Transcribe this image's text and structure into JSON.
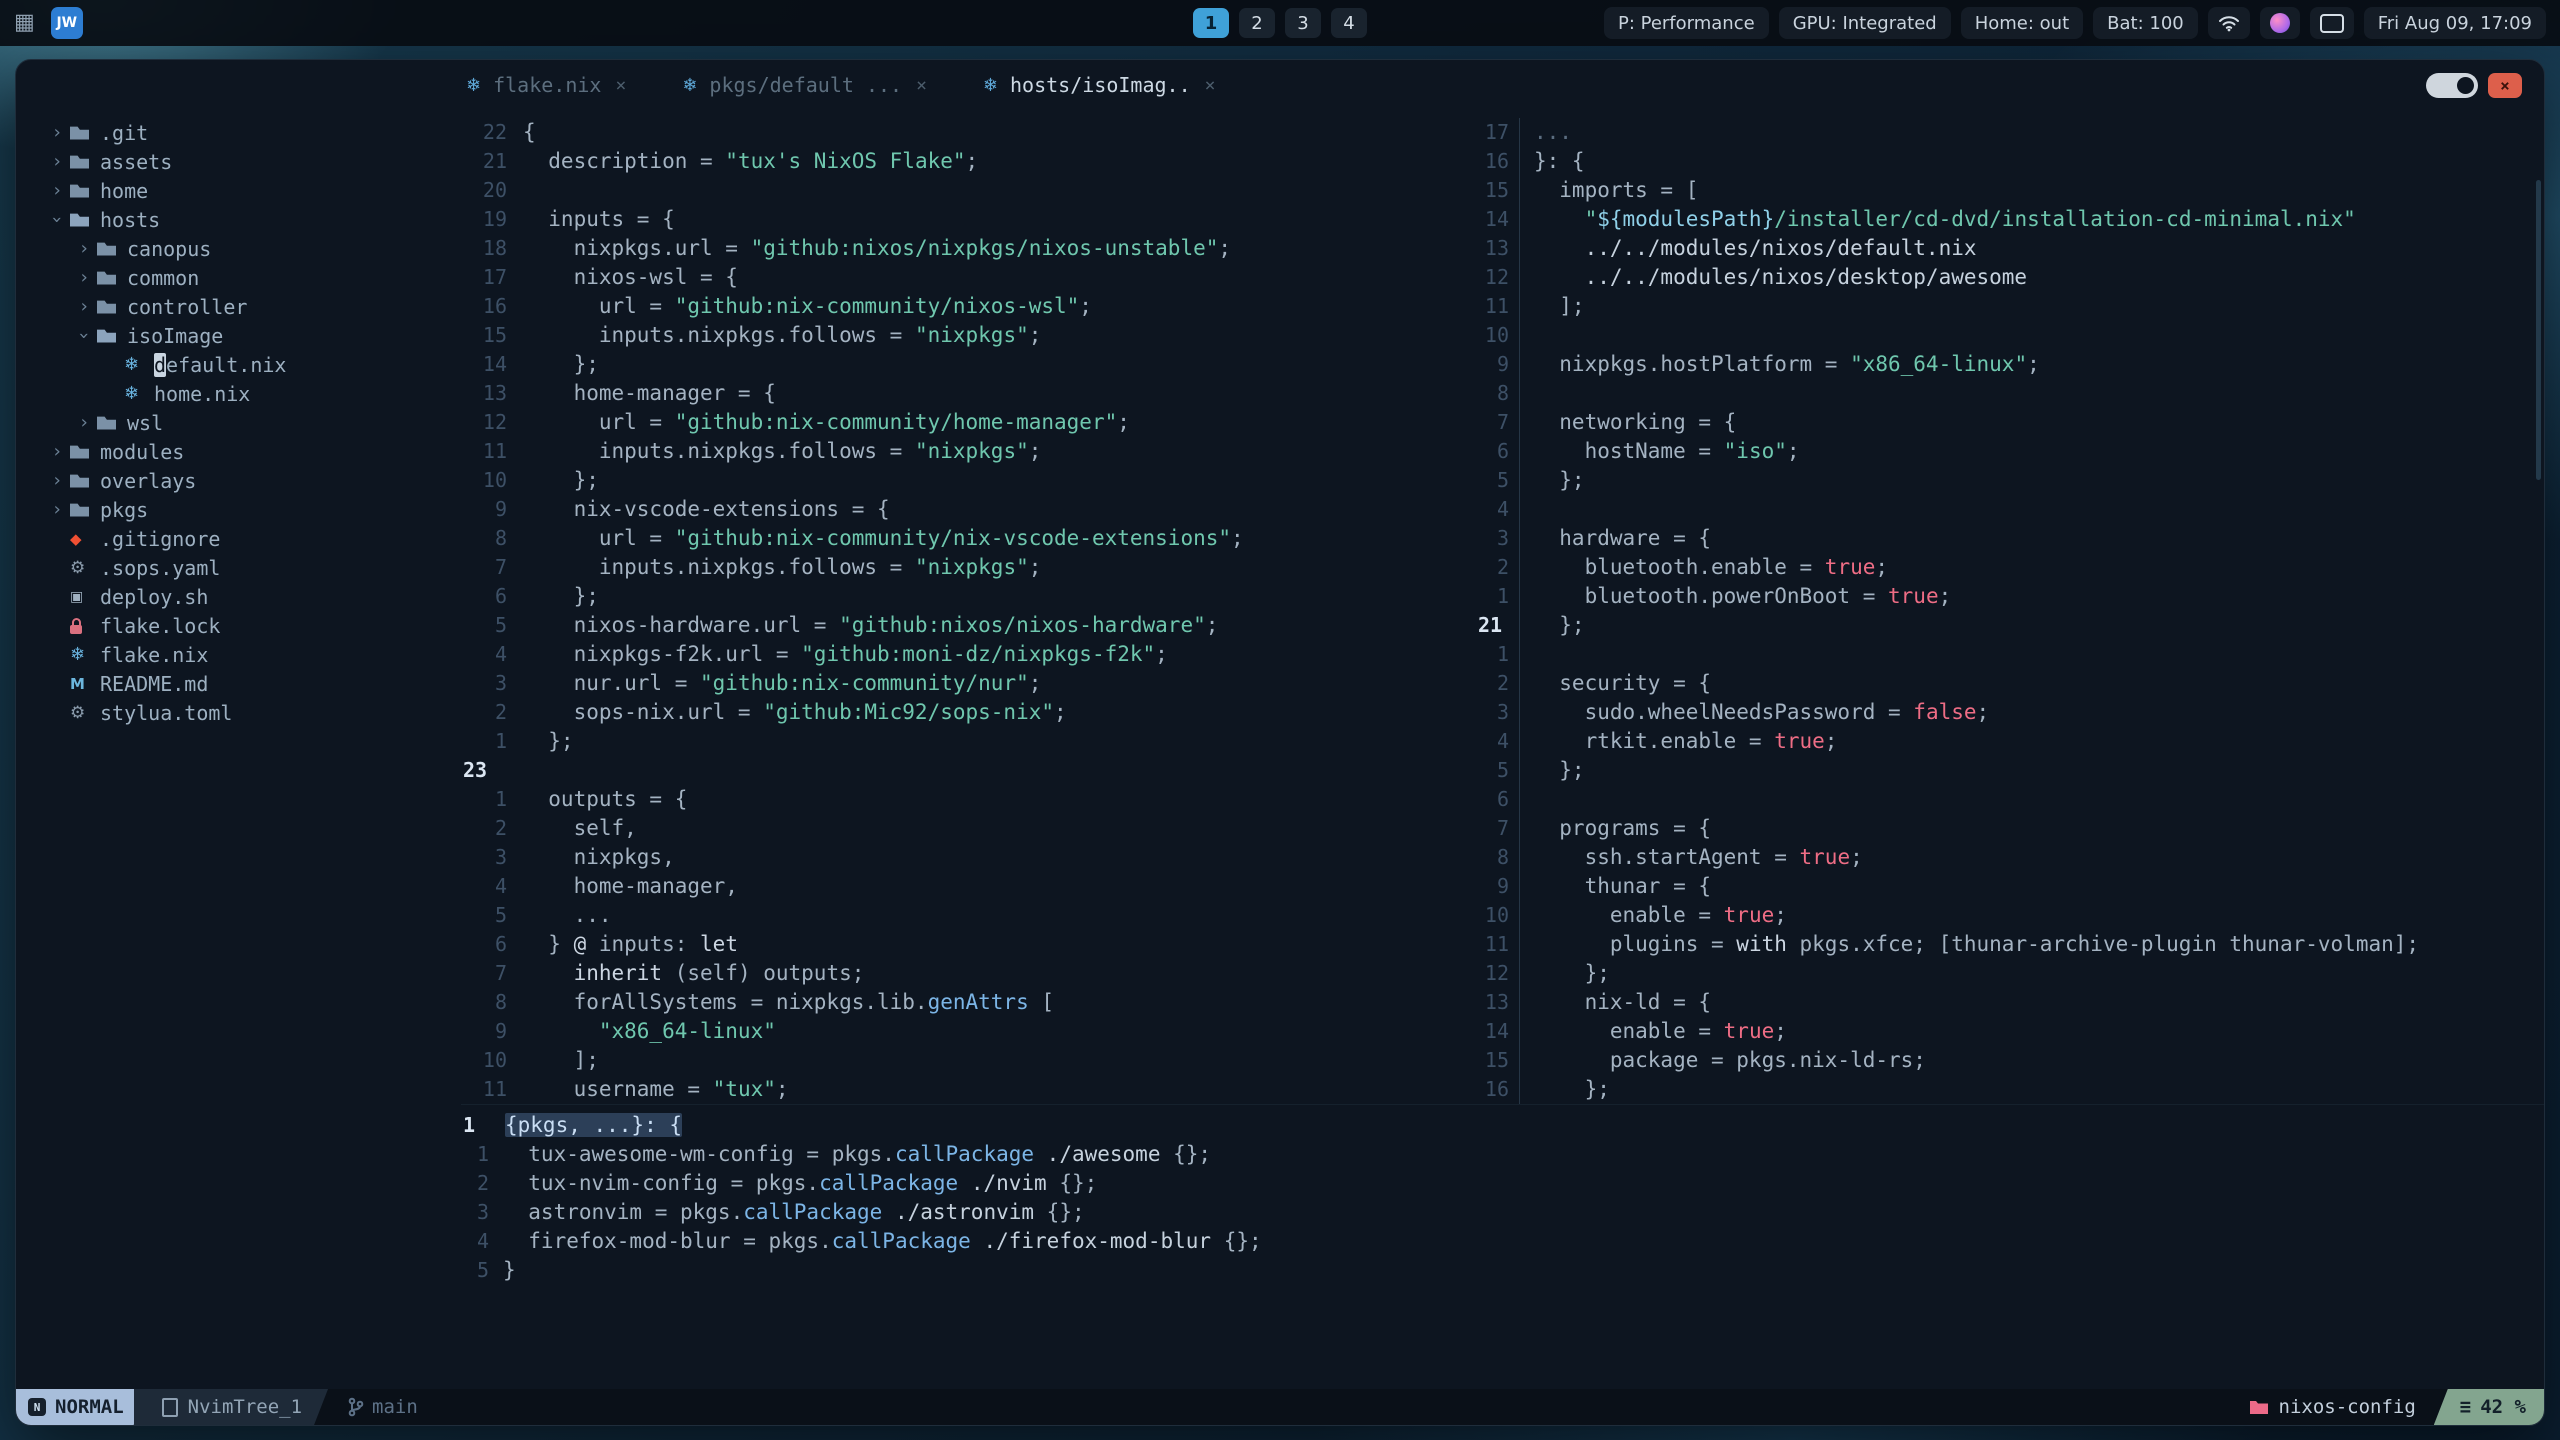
{
  "topbar": {
    "logo": "JW",
    "workspaces": {
      "items": [
        "1",
        "2",
        "3",
        "4"
      ],
      "active": "1"
    },
    "status_items": [
      "P: Performance",
      "GPU: Integrated",
      "Home: out",
      "Bat: 100"
    ],
    "clock": "Fri Aug 09, 17:09"
  },
  "window": {
    "tabs": [
      {
        "label": "flake.nix",
        "icon": "nix",
        "active": false
      },
      {
        "label": "pkgs/default ...",
        "icon": "nix",
        "active": false
      },
      {
        "label": "hosts/isoImag..",
        "icon": "nix",
        "active": true
      }
    ]
  },
  "tree": {
    "items": [
      {
        "indent": 0,
        "arrow": "closed",
        "icon": "folder",
        "label": ".git"
      },
      {
        "indent": 0,
        "arrow": "closed",
        "icon": "folder",
        "label": "assets"
      },
      {
        "indent": 0,
        "arrow": "closed",
        "icon": "folder",
        "label": "home"
      },
      {
        "indent": 0,
        "arrow": "open",
        "icon": "folder-open",
        "label": "hosts"
      },
      {
        "indent": 1,
        "arrow": "closed",
        "icon": "folder",
        "label": "canopus"
      },
      {
        "indent": 1,
        "arrow": "closed",
        "icon": "folder",
        "label": "common"
      },
      {
        "indent": 1,
        "arrow": "closed",
        "icon": "folder",
        "label": "controller"
      },
      {
        "indent": 1,
        "arrow": "open",
        "icon": "folder-open",
        "label": "isoImage"
      },
      {
        "indent": 2,
        "arrow": "none",
        "icon": "nix",
        "label": "default.nix",
        "cursor": true
      },
      {
        "indent": 2,
        "arrow": "none",
        "icon": "nix",
        "label": "home.nix"
      },
      {
        "indent": 1,
        "arrow": "closed",
        "icon": "folder",
        "label": "wsl"
      },
      {
        "indent": 0,
        "arrow": "closed",
        "icon": "folder",
        "label": "modules"
      },
      {
        "indent": 0,
        "arrow": "closed",
        "icon": "folder",
        "label": "overlays"
      },
      {
        "indent": 0,
        "arrow": "closed",
        "icon": "folder",
        "label": "pkgs"
      },
      {
        "indent": 0,
        "arrow": "none",
        "icon": "git",
        "label": ".gitignore"
      },
      {
        "indent": 0,
        "arrow": "none",
        "icon": "yaml",
        "label": ".sops.yaml"
      },
      {
        "indent": 0,
        "arrow": "none",
        "icon": "shell",
        "label": "deploy.sh"
      },
      {
        "indent": 0,
        "arrow": "none",
        "icon": "lock",
        "label": "flake.lock"
      },
      {
        "indent": 0,
        "arrow": "none",
        "icon": "nix",
        "label": "flake.nix"
      },
      {
        "indent": 0,
        "arrow": "none",
        "icon": "markdown",
        "label": "README.md"
      },
      {
        "indent": 0,
        "arrow": "none",
        "icon": "toml",
        "label": "stylua.toml"
      }
    ]
  },
  "panes": {
    "flake": {
      "lines": [
        [
          "22",
          0,
          [
            [
              "t",
              "{"
            ]
          ]
        ],
        [
          "21",
          0,
          [
            [
              "t",
              "  description = "
            ],
            [
              "s",
              "\"tux's NixOS Flake\""
            ],
            [
              "t",
              ";"
            ]
          ]
        ],
        [
          "20",
          0,
          []
        ],
        [
          "19",
          0,
          [
            [
              "t",
              "  inputs = {"
            ]
          ]
        ],
        [
          "18",
          0,
          [
            [
              "t",
              "    nixpkgs.url = "
            ],
            [
              "s",
              "\"github:nixos/nixpkgs/nixos-unstable\""
            ],
            [
              "t",
              ";"
            ]
          ]
        ],
        [
          "17",
          0,
          [
            [
              "t",
              "    nixos-wsl = {"
            ]
          ]
        ],
        [
          "16",
          0,
          [
            [
              "t",
              "      url = "
            ],
            [
              "s",
              "\"github:nix-community/nixos-wsl\""
            ],
            [
              "t",
              ";"
            ]
          ]
        ],
        [
          "15",
          0,
          [
            [
              "t",
              "      inputs.nixpkgs.follows = "
            ],
            [
              "s",
              "\"nixpkgs\""
            ],
            [
              "t",
              ";"
            ]
          ]
        ],
        [
          "14",
          0,
          [
            [
              "t",
              "    };"
            ]
          ]
        ],
        [
          "13",
          0,
          [
            [
              "t",
              "    home-manager = {"
            ]
          ]
        ],
        [
          "12",
          0,
          [
            [
              "t",
              "      url = "
            ],
            [
              "s",
              "\"github:nix-community/home-manager\""
            ],
            [
              "t",
              ";"
            ]
          ]
        ],
        [
          "11",
          0,
          [
            [
              "t",
              "      inputs.nixpkgs.follows = "
            ],
            [
              "s",
              "\"nixpkgs\""
            ],
            [
              "t",
              ";"
            ]
          ]
        ],
        [
          "10",
          0,
          [
            [
              "t",
              "    };"
            ]
          ]
        ],
        [
          "9",
          0,
          [
            [
              "t",
              "    nix-vscode-extensions = {"
            ]
          ]
        ],
        [
          "8",
          0,
          [
            [
              "t",
              "      url = "
            ],
            [
              "s",
              "\"github:nix-community/nix-vscode-extensions\""
            ],
            [
              "t",
              ";"
            ]
          ]
        ],
        [
          "7",
          0,
          [
            [
              "t",
              "      inputs.nixpkgs.follows = "
            ],
            [
              "s",
              "\"nixpkgs\""
            ],
            [
              "t",
              ";"
            ]
          ]
        ],
        [
          "6",
          0,
          [
            [
              "t",
              "    };"
            ]
          ]
        ],
        [
          "5",
          0,
          [
            [
              "t",
              "    nixos-hardware.url = "
            ],
            [
              "s",
              "\"github:nixos/nixos-hardware\""
            ],
            [
              "t",
              ";"
            ]
          ]
        ],
        [
          "4",
          0,
          [
            [
              "t",
              "    nixpkgs-f2k.url = "
            ],
            [
              "s",
              "\"github:moni-dz/nixpkgs-f2k\""
            ],
            [
              "t",
              ";"
            ]
          ]
        ],
        [
          "3",
          0,
          [
            [
              "t",
              "    nur.url = "
            ],
            [
              "s",
              "\"github:nix-community/nur\""
            ],
            [
              "t",
              ";"
            ]
          ]
        ],
        [
          "2",
          0,
          [
            [
              "t",
              "    sops-nix.url = "
            ],
            [
              "s",
              "\"github:Mic92/sops-nix\""
            ],
            [
              "t",
              ";"
            ]
          ]
        ],
        [
          "1",
          0,
          [
            [
              "t",
              "  };"
            ]
          ]
        ],
        [
          "23",
          1,
          []
        ],
        [
          "1",
          0,
          [
            [
              "t",
              "  outputs = {"
            ]
          ]
        ],
        [
          "2",
          0,
          [
            [
              "t",
              "    self,"
            ]
          ]
        ],
        [
          "3",
          0,
          [
            [
              "t",
              "    nixpkgs,"
            ]
          ]
        ],
        [
          "4",
          0,
          [
            [
              "t",
              "    home-manager,"
            ]
          ]
        ],
        [
          "5",
          0,
          [
            [
              "t",
              "    ..."
            ]
          ]
        ],
        [
          "6",
          0,
          [
            [
              "t",
              "  } "
            ],
            [
              "k",
              "@"
            ],
            [
              "t",
              " inputs: "
            ],
            [
              "k",
              "let"
            ]
          ]
        ],
        [
          "7",
          0,
          [
            [
              "t",
              "    "
            ],
            [
              "k",
              "inherit"
            ],
            [
              "t",
              " (self) outputs;"
            ]
          ]
        ],
        [
          "8",
          0,
          [
            [
              "t",
              "    forAllSystems = nixpkgs.lib."
            ],
            [
              "f",
              "genAttrs"
            ],
            [
              "t",
              " ["
            ]
          ]
        ],
        [
          "9",
          0,
          [
            [
              "s",
              "      \"x86_64-linux\""
            ]
          ]
        ],
        [
          "10",
          0,
          [
            [
              "t",
              "    ];"
            ]
          ]
        ],
        [
          "11",
          0,
          [
            [
              "t",
              "    username = "
            ],
            [
              "s",
              "\"tux\""
            ],
            [
              "t",
              ";"
            ]
          ]
        ]
      ]
    },
    "iso": {
      "lines": [
        [
          "17",
          0,
          [
            [
              "g",
              "..."
            ]
          ]
        ],
        [
          "16",
          0,
          [
            [
              "t",
              "}: {"
            ]
          ]
        ],
        [
          "15",
          0,
          [
            [
              "t",
              "  imports = ["
            ]
          ]
        ],
        [
          "14",
          0,
          [
            [
              "s",
              "    \""
            ],
            [
              "i",
              "${modulesPath}"
            ],
            [
              "s",
              "/installer/cd-dvd/installation-cd-minimal.nix\""
            ]
          ]
        ],
        [
          "13",
          0,
          [
            [
              "w",
              "    ../../modules/nixos/default.nix"
            ]
          ]
        ],
        [
          "12",
          0,
          [
            [
              "w",
              "    ../../modules/nixos/desktop/awesome"
            ]
          ]
        ],
        [
          "11",
          0,
          [
            [
              "t",
              "  ];"
            ]
          ]
        ],
        [
          "10",
          0,
          []
        ],
        [
          "9",
          0,
          [
            [
              "t",
              "  nixpkgs.hostPlatform = "
            ],
            [
              "s",
              "\"x86_64-linux\""
            ],
            [
              "t",
              ";"
            ]
          ]
        ],
        [
          "8",
          0,
          []
        ],
        [
          "7",
          0,
          [
            [
              "t",
              "  networking = {"
            ]
          ]
        ],
        [
          "6",
          0,
          [
            [
              "t",
              "    hostName = "
            ],
            [
              "s",
              "\"iso\""
            ],
            [
              "t",
              ";"
            ]
          ]
        ],
        [
          "5",
          0,
          [
            [
              "t",
              "  };"
            ]
          ]
        ],
        [
          "4",
          0,
          []
        ],
        [
          "3",
          0,
          [
            [
              "t",
              "  hardware = {"
            ]
          ]
        ],
        [
          "2",
          0,
          [
            [
              "t",
              "    bluetooth.enable = "
            ],
            [
              "b",
              "true"
            ],
            [
              "t",
              ";"
            ]
          ]
        ],
        [
          "1",
          0,
          [
            [
              "t",
              "    bluetooth.powerOnBoot = "
            ],
            [
              "b",
              "true"
            ],
            [
              "t",
              ";"
            ]
          ]
        ],
        [
          "21",
          1,
          [
            [
              "t",
              "  };"
            ]
          ]
        ],
        [
          "1",
          0,
          []
        ],
        [
          "2",
          0,
          [
            [
              "t",
              "  security = {"
            ]
          ]
        ],
        [
          "3",
          0,
          [
            [
              "t",
              "    sudo.wheelNeedsPassword = "
            ],
            [
              "b",
              "false"
            ],
            [
              "t",
              ";"
            ]
          ]
        ],
        [
          "4",
          0,
          [
            [
              "t",
              "    rtkit.enable = "
            ],
            [
              "b",
              "true"
            ],
            [
              "t",
              ";"
            ]
          ]
        ],
        [
          "5",
          0,
          [
            [
              "t",
              "  };"
            ]
          ]
        ],
        [
          "6",
          0,
          []
        ],
        [
          "7",
          0,
          [
            [
              "t",
              "  programs = {"
            ]
          ]
        ],
        [
          "8",
          0,
          [
            [
              "t",
              "    ssh.startAgent = "
            ],
            [
              "b",
              "true"
            ],
            [
              "t",
              ";"
            ]
          ]
        ],
        [
          "9",
          0,
          [
            [
              "t",
              "    thunar = {"
            ]
          ]
        ],
        [
          "10",
          0,
          [
            [
              "t",
              "      enable = "
            ],
            [
              "b",
              "true"
            ],
            [
              "t",
              ";"
            ]
          ]
        ],
        [
          "11",
          0,
          [
            [
              "t",
              "      plugins = "
            ],
            [
              "k",
              "with"
            ],
            [
              "t",
              " pkgs.xfce; [thunar-archive-plugin thunar-volman];"
            ]
          ]
        ],
        [
          "12",
          0,
          [
            [
              "t",
              "    };"
            ]
          ]
        ],
        [
          "13",
          0,
          [
            [
              "t",
              "    nix-ld = {"
            ]
          ]
        ],
        [
          "14",
          0,
          [
            [
              "t",
              "      enable = "
            ],
            [
              "b",
              "true"
            ],
            [
              "t",
              ";"
            ]
          ]
        ],
        [
          "15",
          0,
          [
            [
              "t",
              "      package = pkgs.nix-ld-rs;"
            ]
          ]
        ],
        [
          "16",
          0,
          [
            [
              "t",
              "    };"
            ]
          ]
        ]
      ]
    },
    "pkgs": {
      "lines": [
        [
          "1",
          1,
          [
            [
              "hl",
              "{pkgs, ...}: {"
            ]
          ]
        ],
        [
          "1",
          0,
          [
            [
              "t",
              "  tux-awesome-wm-config = pkgs."
            ],
            [
              "f",
              "callPackage"
            ],
            [
              "t",
              " "
            ],
            [
              "w",
              "./awesome"
            ],
            [
              "t",
              " {};"
            ]
          ]
        ],
        [
          "2",
          0,
          [
            [
              "t",
              "  tux-nvim-config = pkgs."
            ],
            [
              "f",
              "callPackage"
            ],
            [
              "t",
              " "
            ],
            [
              "w",
              "./nvim"
            ],
            [
              "t",
              " {};"
            ]
          ]
        ],
        [
          "3",
          0,
          [
            [
              "t",
              "  astronvim = pkgs."
            ],
            [
              "f",
              "callPackage"
            ],
            [
              "t",
              " "
            ],
            [
              "w",
              "./astronvim"
            ],
            [
              "t",
              " {};"
            ]
          ]
        ],
        [
          "4",
          0,
          [
            [
              "t",
              "  firefox-mod-blur = pkgs."
            ],
            [
              "f",
              "callPackage"
            ],
            [
              "t",
              " "
            ],
            [
              "w",
              "./firefox-mod-blur"
            ],
            [
              "t",
              " {};"
            ]
          ]
        ],
        [
          "5",
          0,
          [
            [
              "t",
              "}"
            ]
          ]
        ]
      ]
    }
  },
  "statusbar": {
    "mode": "NORMAL",
    "buffer": "NvimTree_1",
    "branch": "main",
    "project": "nixos-config",
    "progress": "42 %"
  },
  "colors": {
    "string_teal": "#6fc7ae",
    "boolean_pink": "#ee6d85",
    "function_blue": "#7cb5e6",
    "mode_badge": "#a8bedb",
    "progress_badge": "#83a58f",
    "close_button": "#dd5f4b",
    "workspace_active": "#3fa1d8",
    "project_icon": "#ec6a88",
    "nix_icon": "#69b3df"
  }
}
